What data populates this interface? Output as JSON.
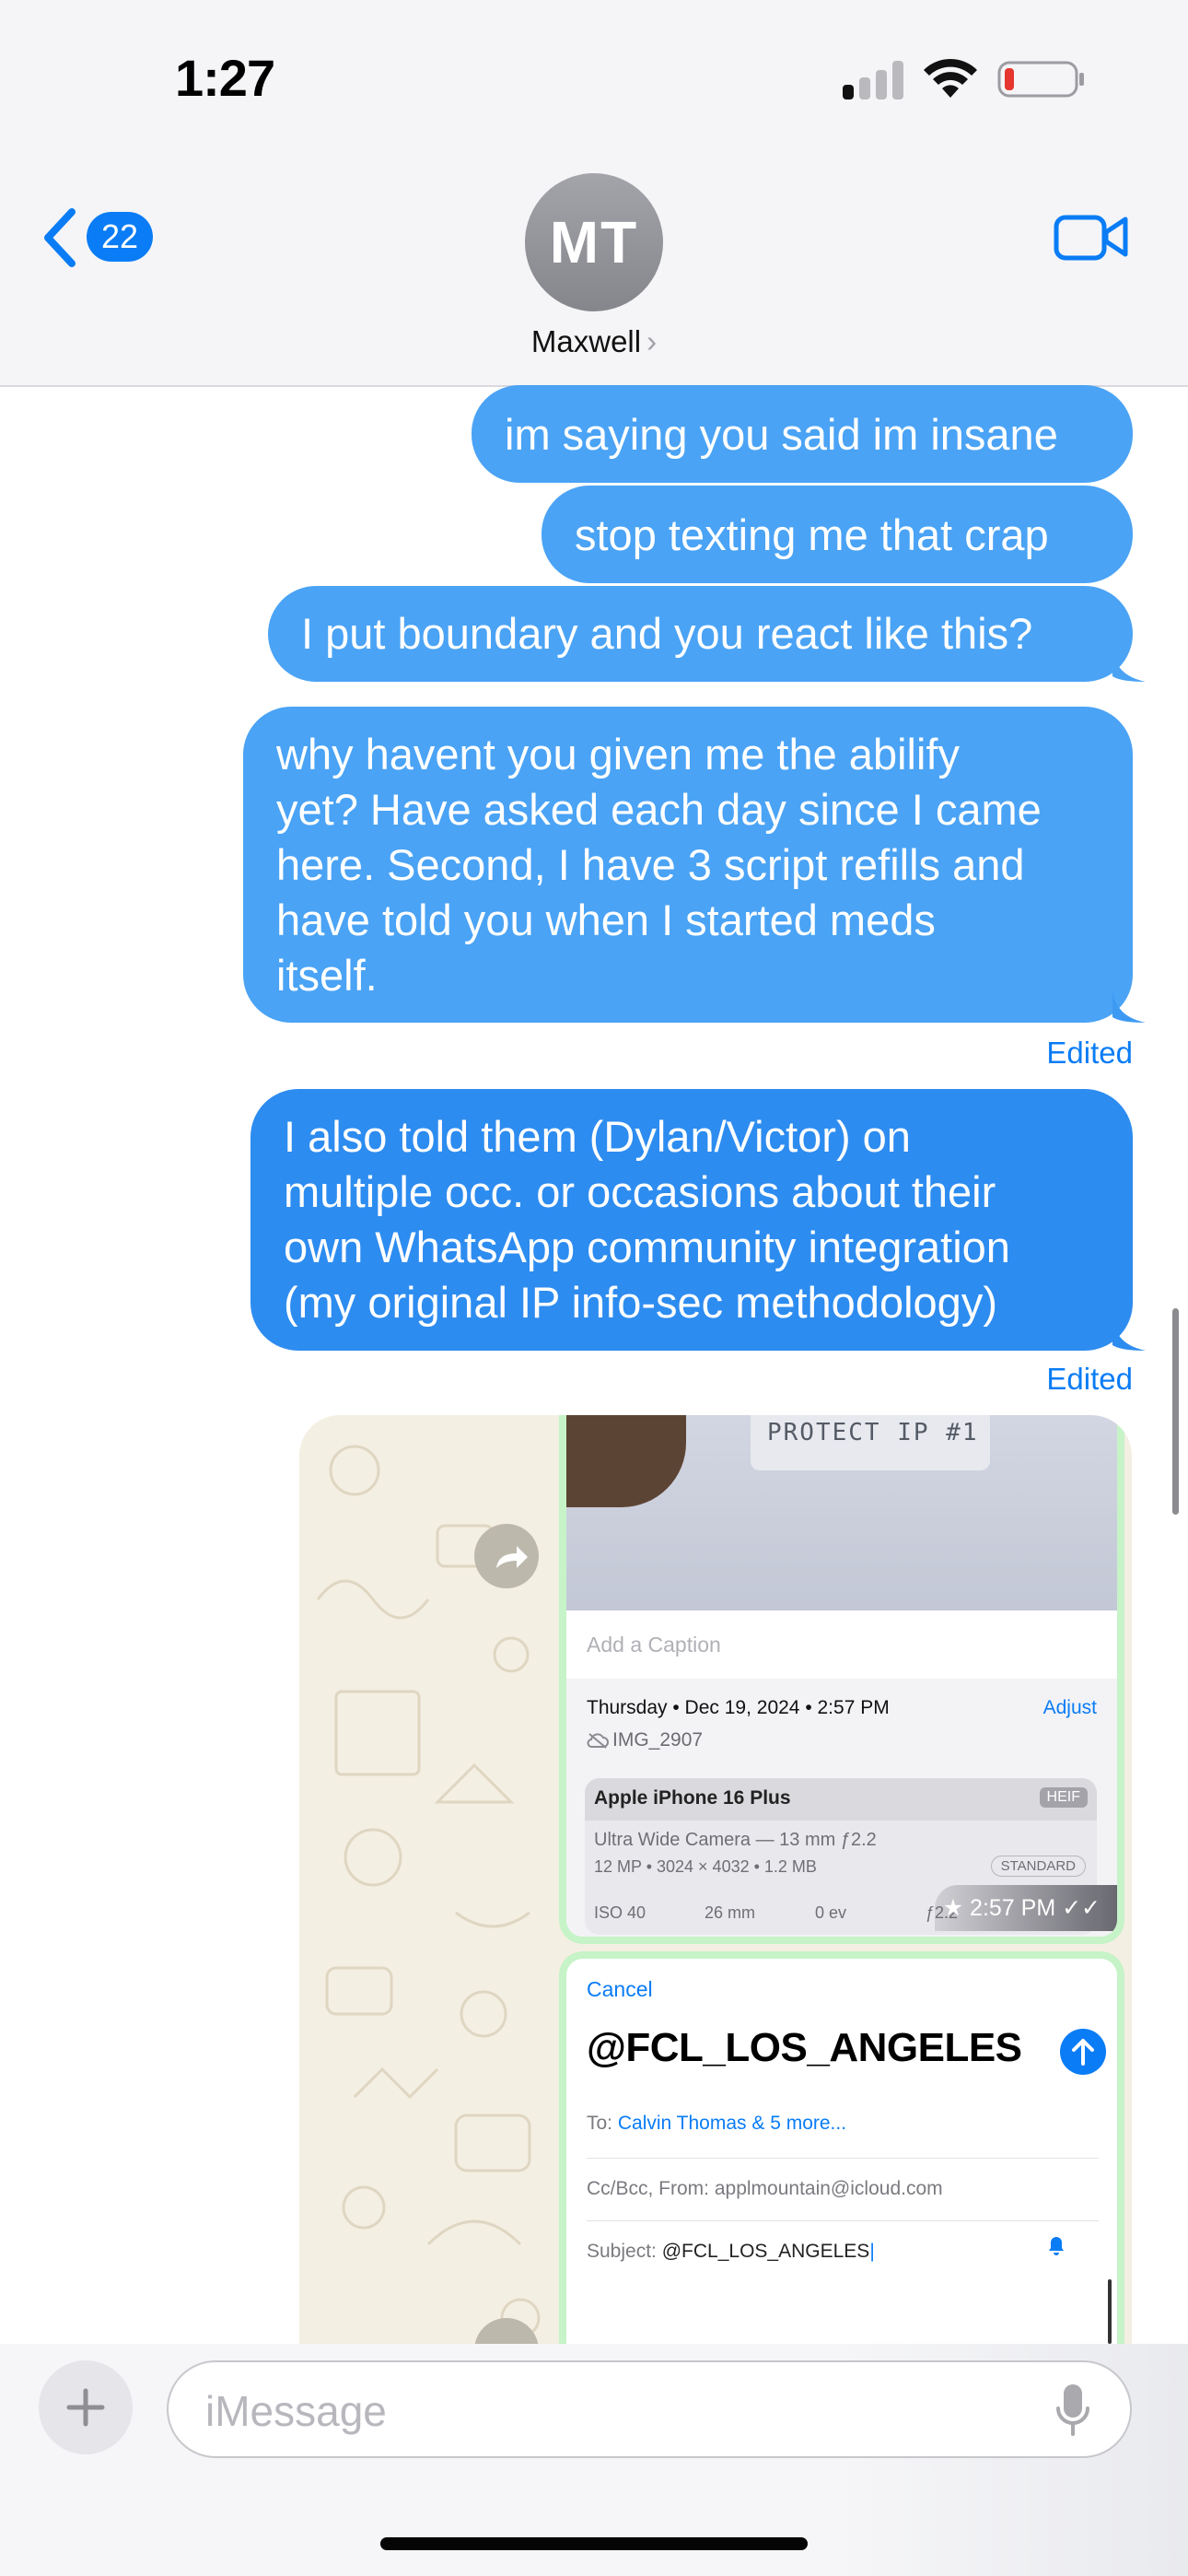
{
  "status_bar": {
    "time": "1:27",
    "signal_bars": 1,
    "battery_level": 0.1
  },
  "header": {
    "back_count": "22",
    "avatar_initials": "MT",
    "contact_name": "Maxwell",
    "contact_chevron": "›",
    "icons": [
      "chevron-left-icon",
      "video-camera-icon"
    ]
  },
  "messages": [
    {
      "lines": [
        "im saying you said im insane"
      ]
    },
    {
      "lines": [
        "stop texting me that crap"
      ]
    },
    {
      "lines": [
        "I put boundary and you react like this?"
      ]
    },
    {
      "lines": [
        "why havent you given me the abilify",
        "yet? Have asked each day since I came",
        "here. Second, I have 3 script refills and",
        "have told you when I started meds",
        "itself."
      ],
      "status": "Edited"
    },
    {
      "lines": [
        "I also told them (Dylan/Victor) on",
        "multiple occ. or occasions about their",
        "own WhatsApp community integration",
        "(my original IP info-sec methodology)"
      ],
      "status": "Edited"
    }
  ],
  "attachment": {
    "photo_text": "PROTECT IP #1",
    "photo_card": {
      "caption_placeholder": "Add a Caption",
      "date": "Thursday • Dec 19, 2024 • 2:57 PM",
      "adjust": "Adjust",
      "filename": "IMG_2907",
      "device": "Apple iPhone 16 Plus",
      "format": "HEIF",
      "lens": "Ultra Wide Camera — 13 mm ƒ2.2",
      "resolution": "12 MP • 3024 × 4032 • 1.2 MB",
      "mode": "STANDARD",
      "exif": [
        "ISO 40",
        "26 mm",
        "0 ev",
        "ƒ2.2"
      ],
      "timestamp": "★ 2:57 PM ✓✓"
    },
    "mail_card": {
      "cancel": "Cancel",
      "subject_title": "@FCL_LOS_ANGELES",
      "to_label": "To:",
      "to_value": "Calvin Thomas & 5 more...",
      "ccbcc": "Cc/Bcc, From: applmountain@icloud.com",
      "subject_label": "Subject:",
      "subject_value": "@FCL_LOS_ANGELES"
    }
  },
  "composer": {
    "placeholder": "iMessage",
    "icons": [
      "plus-icon",
      "microphone-icon"
    ]
  },
  "colors": {
    "bubble_light": "#4aa3f5",
    "bubble_dark": "#2d8cf0",
    "accent": "#0a7cf5"
  }
}
